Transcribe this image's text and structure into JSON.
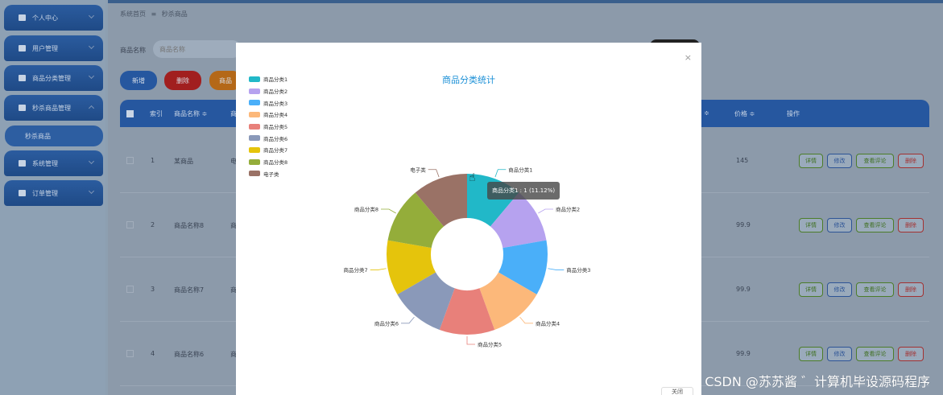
{
  "sidebar": {
    "items": [
      {
        "label": "个人中心",
        "expanded": false
      },
      {
        "label": "用户管理",
        "expanded": false
      },
      {
        "label": "商品分类管理",
        "expanded": false
      },
      {
        "label": "秒杀商品管理",
        "expanded": true
      },
      {
        "label": "系统管理",
        "expanded": false
      },
      {
        "label": "订单管理",
        "expanded": false
      }
    ],
    "sub_item": "秒杀商品"
  },
  "breadcrumb": {
    "home": "系统首页",
    "separator": "≡",
    "current": "秒杀商品"
  },
  "search": {
    "label": "商品名称",
    "placeholder": "商品名称"
  },
  "toolbar": {
    "add": "新增",
    "delete": "删除",
    "more": "商品"
  },
  "table": {
    "headers": {
      "index": "索引",
      "name": "商品名称 ≑",
      "name_cut": "商",
      "price_cut": "≑",
      "price": "价格 ≑",
      "actions": "操作"
    },
    "rows": [
      {
        "index": "1",
        "name": "某商品",
        "col3": "电",
        "price": "145"
      },
      {
        "index": "2",
        "name": "商品名称8",
        "col3": "商",
        "price": "99.9"
      },
      {
        "index": "3",
        "name": "商品名称7",
        "col3": "商",
        "price": "99.9"
      },
      {
        "index": "4",
        "name": "商品名称6",
        "col3": "商",
        "price": "99.9"
      }
    ],
    "actions": {
      "detail": "详情",
      "edit": "修改",
      "review": "查看评论",
      "delete": "删除"
    }
  },
  "modal": {
    "close": "×",
    "title": "商品分类统计",
    "tooltip": "商品分类1 : 1 (11.12%)",
    "footer_button": "关闭"
  },
  "chart_data": {
    "type": "pie",
    "title": "商品分类统计",
    "donut": true,
    "legend_position": "top-left",
    "slices": [
      {
        "name": "商品分类1",
        "value": 1,
        "color": "#21b8c8"
      },
      {
        "name": "商品分类2",
        "value": 1,
        "color": "#b6a2ef"
      },
      {
        "name": "商品分类3",
        "value": 1,
        "color": "#4aaff9"
      },
      {
        "name": "商品分类4",
        "value": 1,
        "color": "#fcb87a"
      },
      {
        "name": "商品分类5",
        "value": 1,
        "color": "#e8807a"
      },
      {
        "name": "商品分类6",
        "value": 1,
        "color": "#8a99b9"
      },
      {
        "name": "商品分类7",
        "value": 1,
        "color": "#e5c40c"
      },
      {
        "name": "商品分类8",
        "value": 1,
        "color": "#94ad3a"
      },
      {
        "name": "电子类",
        "value": 1,
        "color": "#9a7266"
      }
    ]
  },
  "watermark": "CSDN @苏苏酱 ゛计算机毕设源码程序"
}
